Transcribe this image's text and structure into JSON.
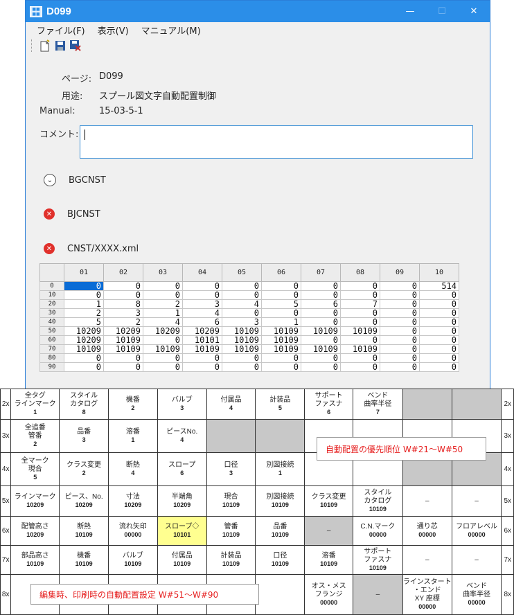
{
  "window": {
    "title": "D099",
    "app_icon_text": "■■ ■■",
    "minimize": "—",
    "maximize": "☐",
    "close": "✕"
  },
  "menu": [
    "ファイル(F)",
    "表示(V)",
    "マニュアル(M)"
  ],
  "toolbar": {
    "new_icon": "new-document-icon",
    "save_icon": "save-icon",
    "save_as_icon": "save-as-icon"
  },
  "info": {
    "page_label": "ページ:",
    "page_value": "D099",
    "usage_label": "用途:",
    "usage_value": "スプール図文字自動配置制御",
    "manual_label": "Manual:",
    "manual_value": "15-03-5-1",
    "comment_label": "コメント:",
    "comment_value": ""
  },
  "status": [
    {
      "icon": "check-circle-icon",
      "glyph": "⌄",
      "label": "BGCNST",
      "kind": "ok"
    },
    {
      "icon": "error-circle-icon",
      "glyph": "✕",
      "label": "BJCNST",
      "kind": "err"
    },
    {
      "icon": "error-circle-icon",
      "glyph": "✕",
      "label": "CNST/XXXX.xml",
      "kind": "err"
    }
  ],
  "grid": {
    "columns": [
      "01",
      "02",
      "03",
      "04",
      "05",
      "06",
      "07",
      "08",
      "09",
      "10"
    ],
    "rows": [
      {
        "label": "0",
        "cells": [
          "0",
          "0",
          "0",
          "0",
          "0",
          "0",
          "0",
          "0",
          "0",
          "514"
        ]
      },
      {
        "label": "10",
        "cells": [
          "0",
          "0",
          "0",
          "0",
          "0",
          "0",
          "0",
          "0",
          "0",
          "0"
        ]
      },
      {
        "label": "20",
        "cells": [
          "1",
          "8",
          "2",
          "3",
          "4",
          "5",
          "6",
          "7",
          "0",
          "0"
        ]
      },
      {
        "label": "30",
        "cells": [
          "2",
          "3",
          "1",
          "4",
          "0",
          "0",
          "0",
          "0",
          "0",
          "0"
        ]
      },
      {
        "label": "40",
        "cells": [
          "5",
          "2",
          "4",
          "6",
          "3",
          "1",
          "0",
          "0",
          "0",
          "0"
        ]
      },
      {
        "label": "50",
        "cells": [
          "10209",
          "10209",
          "10209",
          "10209",
          "10109",
          "10109",
          "10109",
          "10109",
          "0",
          "0"
        ]
      },
      {
        "label": "60",
        "cells": [
          "10209",
          "10109",
          "0",
          "10101",
          "10109",
          "10109",
          "0",
          "0",
          "0",
          "0"
        ]
      },
      {
        "label": "70",
        "cells": [
          "10109",
          "10109",
          "10109",
          "10109",
          "10109",
          "10109",
          "10109",
          "10109",
          "0",
          "0"
        ]
      },
      {
        "label": "80",
        "cells": [
          "0",
          "0",
          "0",
          "0",
          "0",
          "0",
          "0",
          "0",
          "0",
          "0"
        ]
      },
      {
        "label": "90",
        "cells": [
          "0",
          "0",
          "0",
          "0",
          "0",
          "0",
          "0",
          "0",
          "0",
          "0"
        ]
      }
    ]
  },
  "overlay": {
    "rows": [
      {
        "side": "2x",
        "cells": [
          {
            "label": "全タグ\nラインマーク",
            "value": "1"
          },
          {
            "label": "スタイル\nカタログ",
            "value": "8"
          },
          {
            "label": "機番",
            "value": "2"
          },
          {
            "label": "バルブ",
            "value": "3"
          },
          {
            "label": "付属品",
            "value": "4"
          },
          {
            "label": "計装品",
            "value": "5"
          },
          {
            "label": "サポート\nファスナ",
            "value": "6"
          },
          {
            "label": "ベンド\n曲率半径",
            "value": "7"
          },
          {
            "gray": true
          },
          {
            "gray": true
          }
        ]
      },
      {
        "side": "3x",
        "cells": [
          {
            "label": "全追番\n管番",
            "value": "2"
          },
          {
            "label": "品番",
            "value": "3"
          },
          {
            "label": "溶番",
            "value": "1"
          },
          {
            "label": "ピースNo.",
            "value": "4"
          },
          {
            "gray": true
          },
          {
            "gray": true
          },
          {
            "blank": true
          },
          {
            "blank": true
          },
          {
            "blank": true
          },
          {
            "blank": true
          }
        ]
      },
      {
        "side": "4x",
        "cells": [
          {
            "label": "全マーク\n現合",
            "value": "5"
          },
          {
            "label": "クラス変更",
            "value": "2"
          },
          {
            "label": "断熱",
            "value": "4"
          },
          {
            "label": "スロープ",
            "value": "6"
          },
          {
            "label": "口径",
            "value": "3"
          },
          {
            "label": "別図接続",
            "value": "1"
          },
          {
            "blank": true
          },
          {
            "blank": true
          },
          {
            "gray": true
          },
          {
            "gray": true
          }
        ]
      },
      {
        "side": "5x",
        "cells": [
          {
            "label": "ラインマーク",
            "value": "10209"
          },
          {
            "label": "ピース、No.",
            "value": "10209"
          },
          {
            "label": "寸法",
            "value": "10209"
          },
          {
            "label": "半端角",
            "value": "10209"
          },
          {
            "label": "現合",
            "value": "10109"
          },
          {
            "label": "別図接続",
            "value": "10109"
          },
          {
            "label": "クラス変更",
            "value": "10109"
          },
          {
            "label": "スタイル\nカタログ",
            "value": "10109"
          },
          {
            "label": "–",
            "value": ""
          },
          {
            "label": "–",
            "value": ""
          }
        ]
      },
      {
        "side": "6x",
        "cells": [
          {
            "label": "配管高さ",
            "value": "10209"
          },
          {
            "label": "断熱",
            "value": "10109"
          },
          {
            "label": "流れ矢印",
            "value": "00000"
          },
          {
            "label": "スロープ◇",
            "value": "10101",
            "yellow": true
          },
          {
            "label": "管番",
            "value": "10109"
          },
          {
            "label": "品番",
            "value": "10109"
          },
          {
            "label": "–",
            "value": "",
            "gray": true
          },
          {
            "label": "C.N.マーク",
            "value": "00000"
          },
          {
            "label": "通り芯",
            "value": "00000"
          },
          {
            "label": "フロアレベル",
            "value": "00000"
          }
        ]
      },
      {
        "side": "7x",
        "cells": [
          {
            "label": "部品高さ",
            "value": "10109"
          },
          {
            "label": "機番",
            "value": "10109"
          },
          {
            "label": "バルブ",
            "value": "10109"
          },
          {
            "label": "付属品",
            "value": "10109"
          },
          {
            "label": "計装品",
            "value": "10109"
          },
          {
            "label": "口径",
            "value": "10109"
          },
          {
            "label": "溶番",
            "value": "10109"
          },
          {
            "label": "サポート\nファスナ",
            "value": "10109"
          },
          {
            "label": "–",
            "value": ""
          },
          {
            "label": "–",
            "value": ""
          }
        ]
      },
      {
        "side": "8x",
        "cells": [
          {
            "blank": true
          },
          {
            "blank": true
          },
          {
            "blank": true
          },
          {
            "blank": true
          },
          {
            "blank": true
          },
          {
            "blank": true
          },
          {
            "label": "オス・メス\nフランジ",
            "value": "00000"
          },
          {
            "label": "–",
            "value": "",
            "gray": true
          },
          {
            "label": "ラインスタート\n・エンド\nXY 座標",
            "value": "00000"
          },
          {
            "label": "ベンド\n曲率半径",
            "value": "00000"
          }
        ]
      }
    ],
    "note_priority": "自動配置の優先順位 W#21～W#50",
    "note_edit": "編集時、印刷時の自動配置設定 W#51～W#90"
  }
}
